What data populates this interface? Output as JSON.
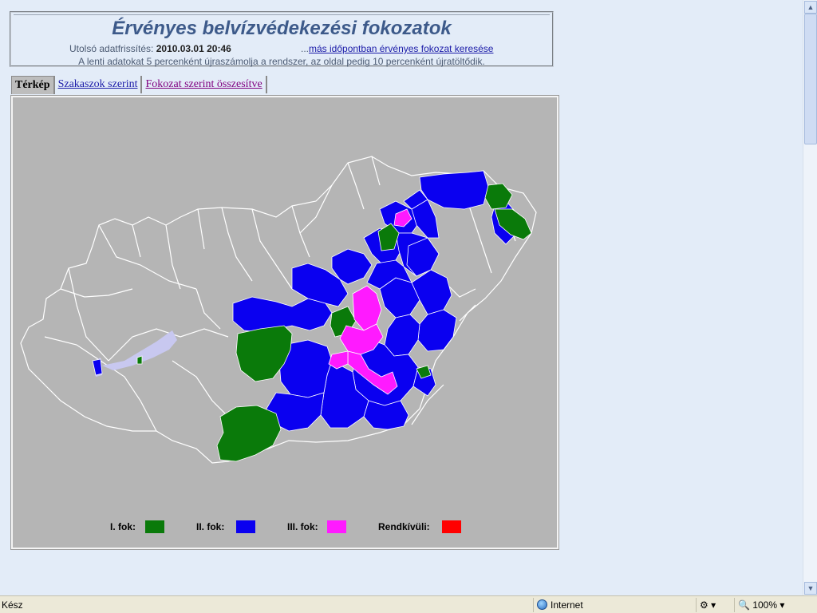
{
  "header": {
    "title": "Érvényes belvízvédekezési fokozatok",
    "update_label": "Utolsó adatfrissítés:",
    "update_value": "2010.03.01 20:46",
    "other_prefix": "...",
    "other_link": "más időpontban érvényes fokozat keresése",
    "info": "A lenti adatokat 5 percenként újraszámolja a rendszer, az oldal pedig 10 percenként újratöltődik."
  },
  "tabs": [
    {
      "label": "Térkép",
      "active": true
    },
    {
      "label": "Szakaszok szerint",
      "active": false
    },
    {
      "label": "Fokozat szerint összesítve",
      "active": false
    }
  ],
  "legend": [
    {
      "label": "I. fok:",
      "color": "#0a7a0a"
    },
    {
      "label": "II. fok:",
      "color": "#0a00f0"
    },
    {
      "label": "III. fok:",
      "color": "#ff1aff"
    },
    {
      "label": "Rendkívüli:",
      "color": "#ff0000"
    }
  ],
  "colors": {
    "map_background": "#b5b5b5",
    "page_background": "#e3ecf8",
    "boundary_lines": "#ffffff",
    "lakes": "#c8c8f0"
  },
  "status": {
    "text": "Kész",
    "zone": "Internet",
    "zoom": "100%"
  }
}
